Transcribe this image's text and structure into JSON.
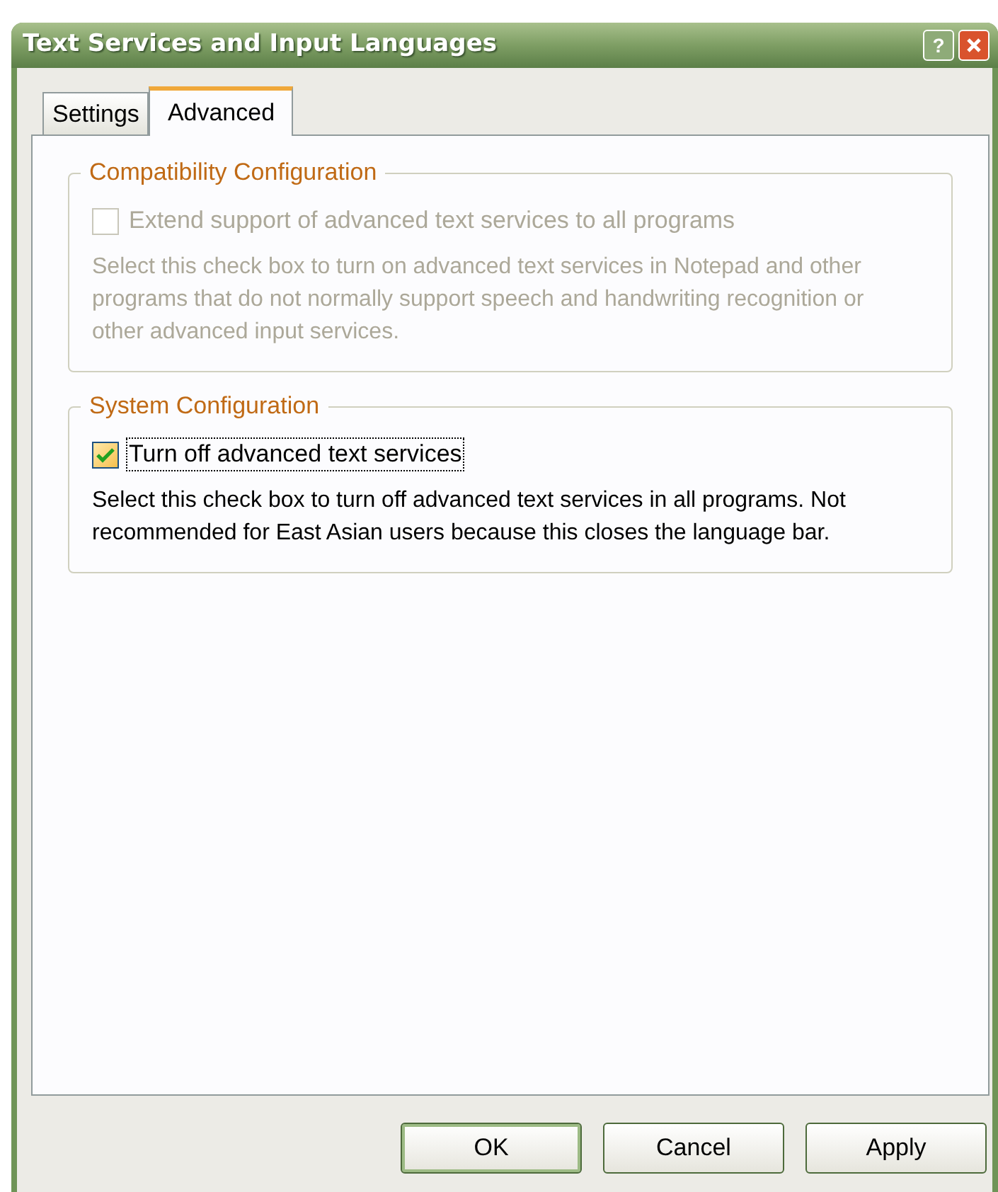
{
  "window": {
    "title": "Text Services and Input Languages",
    "title_buttons": [
      {
        "kind": "help",
        "label": "?"
      },
      {
        "kind": "close"
      }
    ]
  },
  "tabs": [
    {
      "label": "Settings",
      "selected": false
    },
    {
      "label": "Advanced",
      "selected": true
    }
  ],
  "groups": [
    {
      "title": "Compatibility Configuration",
      "disabled": true,
      "checkbox": {
        "label": "Extend support of advanced text services to all programs",
        "checked": false,
        "focused": false
      },
      "description": "Select this check box to turn on advanced text services in Notepad and other programs that do not normally support speech and handwriting recognition or other advanced input services."
    },
    {
      "title": "System Configuration",
      "disabled": false,
      "checkbox": {
        "label": "Turn off advanced text services",
        "checked": true,
        "focused": true
      },
      "description": "Select this check box to turn off advanced text services in all programs. Not recommended for East Asian users because this closes the language bar."
    }
  ],
  "buttons": [
    {
      "label": "OK",
      "default": true
    },
    {
      "label": "Cancel",
      "default": false
    },
    {
      "label": "Apply",
      "default": false
    }
  ]
}
